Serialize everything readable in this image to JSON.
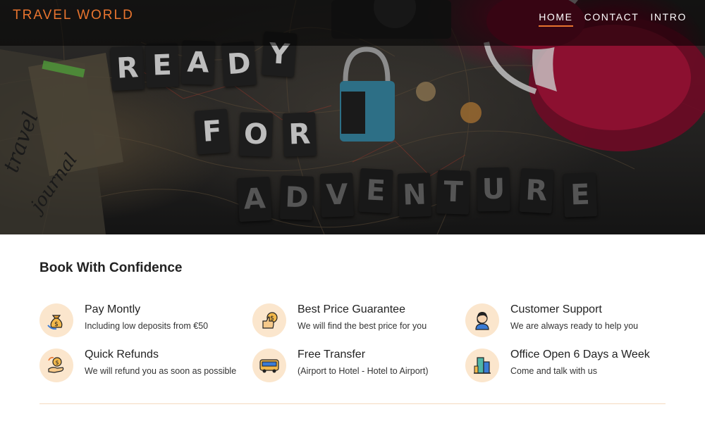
{
  "brand": {
    "name": "TRAVEL WORLD",
    "color": "#e8742e"
  },
  "nav": {
    "items": [
      {
        "label": "HOME",
        "active": true
      },
      {
        "label": "CONTACT",
        "active": false
      },
      {
        "label": "INTRO",
        "active": false
      }
    ]
  },
  "hero": {
    "words": [
      "READY",
      "FOR",
      "ADVENTURE"
    ]
  },
  "section": {
    "title": "Book With Confidence"
  },
  "features": [
    {
      "icon": "money-bag-icon",
      "title": "Pay Montly",
      "desc": "Including low deposits from €50"
    },
    {
      "icon": "thumbs-up-coin-icon",
      "title": "Best Price Guarantee",
      "desc": "We will find the best price for you"
    },
    {
      "icon": "support-agent-icon",
      "title": "Customer Support",
      "desc": "We are always ready to help you"
    },
    {
      "icon": "refund-hand-icon",
      "title": "Quick Refunds",
      "desc": "We will refund you as soon as possible"
    },
    {
      "icon": "bus-icon",
      "title": "Free Transfer",
      "desc": "(Airport to Hotel - Hotel to Airport)"
    },
    {
      "icon": "office-building-icon",
      "title": "Office Open 6 Days a Week",
      "desc": "Come and talk with us"
    }
  ],
  "colors": {
    "accent": "#e8742e",
    "icon_bg": "#fbe6cd",
    "divider": "#f5d9be"
  }
}
